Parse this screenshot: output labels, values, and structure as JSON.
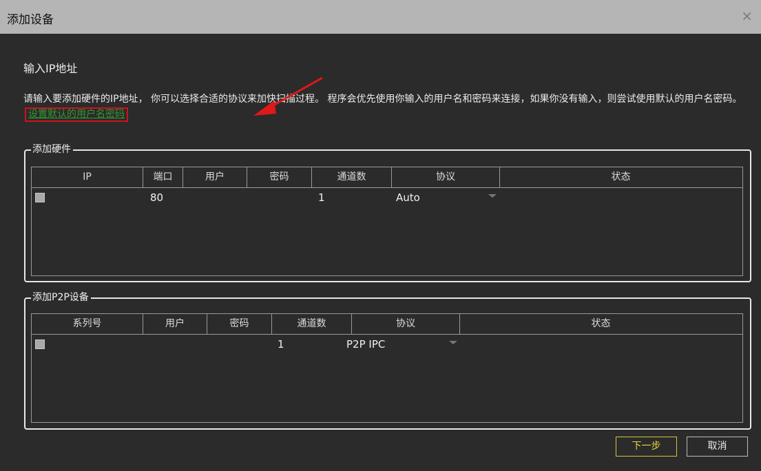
{
  "window": {
    "title": "添加设备",
    "close_glyph": "×"
  },
  "section": {
    "heading": "输入IP地址",
    "description": "请输入要添加硬件的IP地址， 你可以选择合适的协议来加快扫描过程。 程序会优先使用你输入的用户名和密码来连接，如果你没有输入，则尝试使用默认的用户名密码。",
    "link": "设置默认的用户名密码"
  },
  "hardware": {
    "label": "添加硬件",
    "columns": [
      "IP",
      "端口",
      "用户",
      "密码",
      "通道数",
      "协议",
      "状态"
    ],
    "rows": [
      {
        "checked": false,
        "ip": "",
        "port": "80",
        "user": "",
        "password": "",
        "channels": "1",
        "protocol": "Auto",
        "status": ""
      }
    ]
  },
  "p2p": {
    "label": "添加P2P设备",
    "columns": [
      "系列号",
      "用户",
      "密码",
      "通道数",
      "协议",
      "状态"
    ],
    "rows": [
      {
        "checked": false,
        "serial": "",
        "user": "",
        "password": "",
        "channels": "1",
        "protocol": "P2P IPC",
        "status": ""
      }
    ]
  },
  "buttons": {
    "next": "下一步",
    "cancel": "取消"
  },
  "colors": {
    "titlebar": "#b5b5b5",
    "background": "#2b2b2b",
    "link": "#2e9a2e",
    "highlight_box": "#d0121b",
    "next_border": "#d8c438"
  }
}
